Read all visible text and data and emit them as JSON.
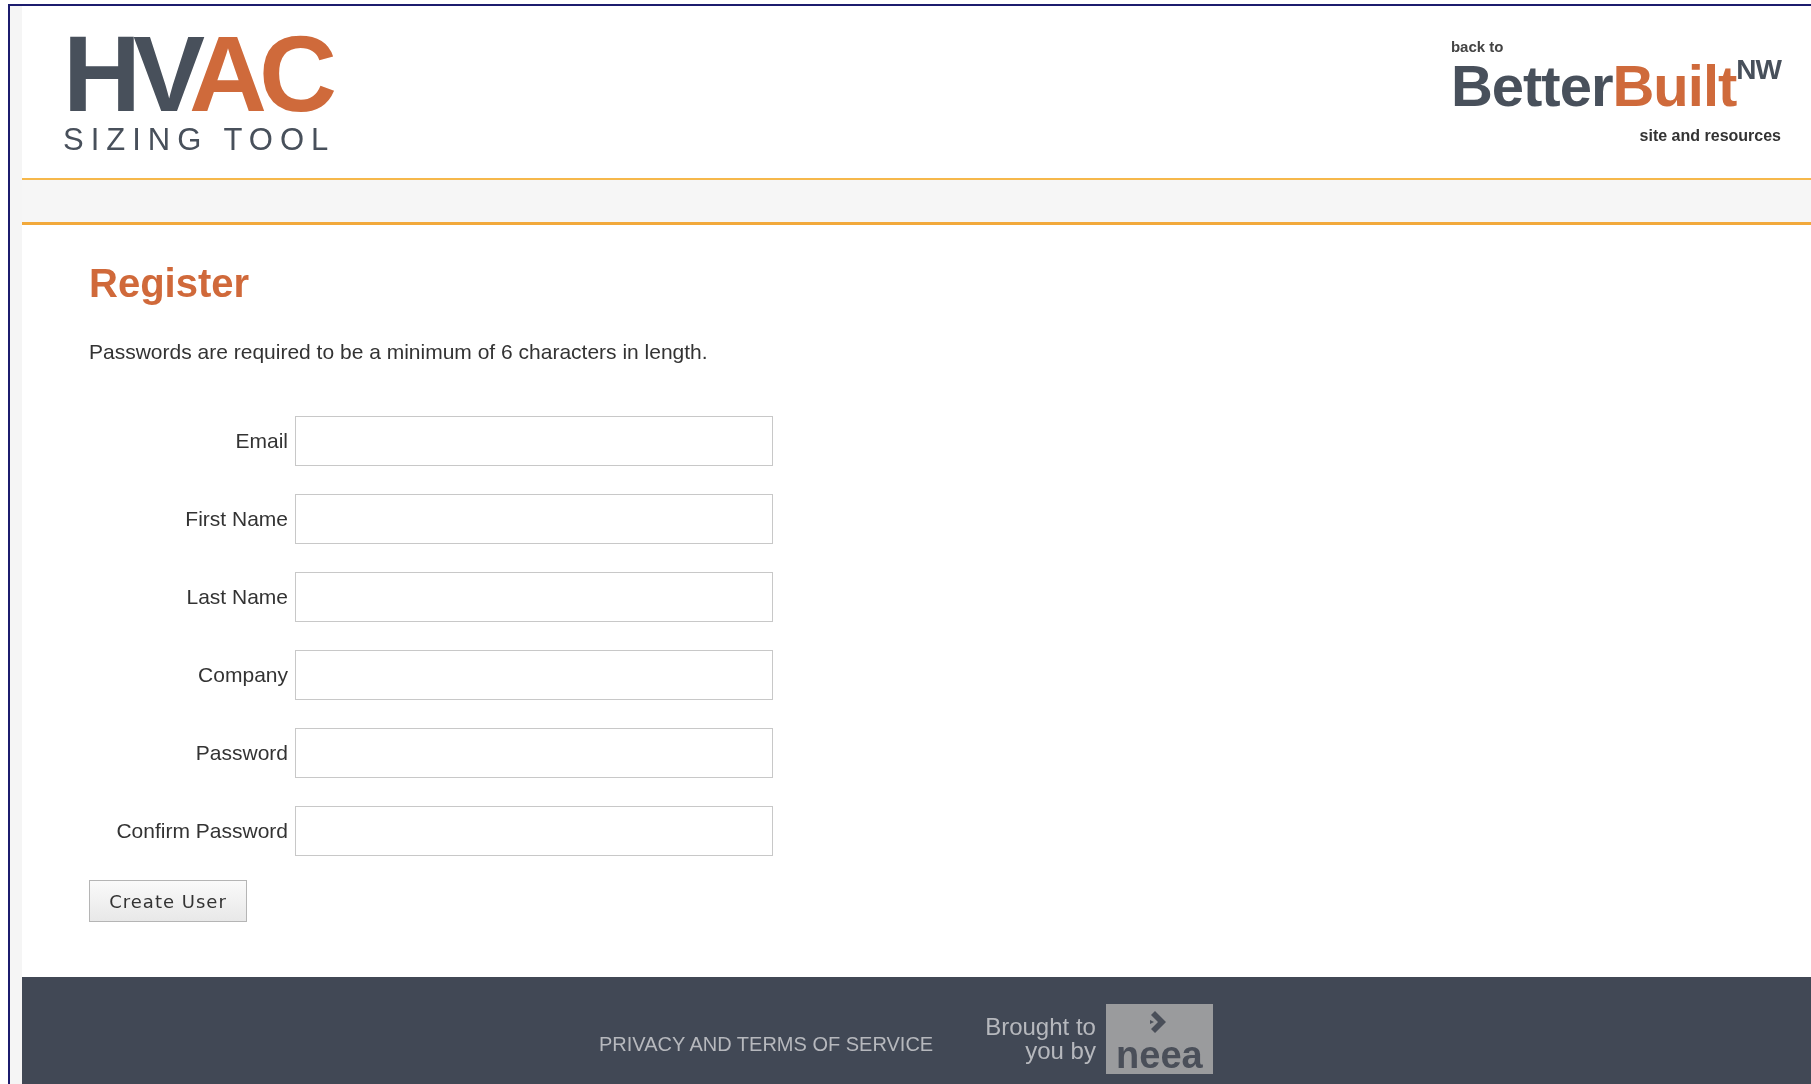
{
  "header": {
    "logo": {
      "dark": "HV",
      "accent": "AC",
      "subtitle": "SIZING TOOL"
    },
    "back_link": {
      "prefix": "back to",
      "dark": "Better",
      "accent": "Built",
      "superscript": "NW",
      "suffix": "site and resources"
    }
  },
  "page": {
    "title": "Register",
    "note": "Passwords are required to be a minimum of 6 characters in length."
  },
  "form": {
    "fields": [
      {
        "label": "Email"
      },
      {
        "label": "First Name"
      },
      {
        "label": "Last Name"
      },
      {
        "label": "Company"
      },
      {
        "label": "Password"
      },
      {
        "label": "Confirm Password"
      }
    ],
    "submit": "Create User"
  },
  "footer": {
    "link": "PRIVACY AND TERMS OF SERVICE",
    "credit_line_1": "Brought to",
    "credit_line_2": "you by",
    "sponsor": "neea"
  }
}
